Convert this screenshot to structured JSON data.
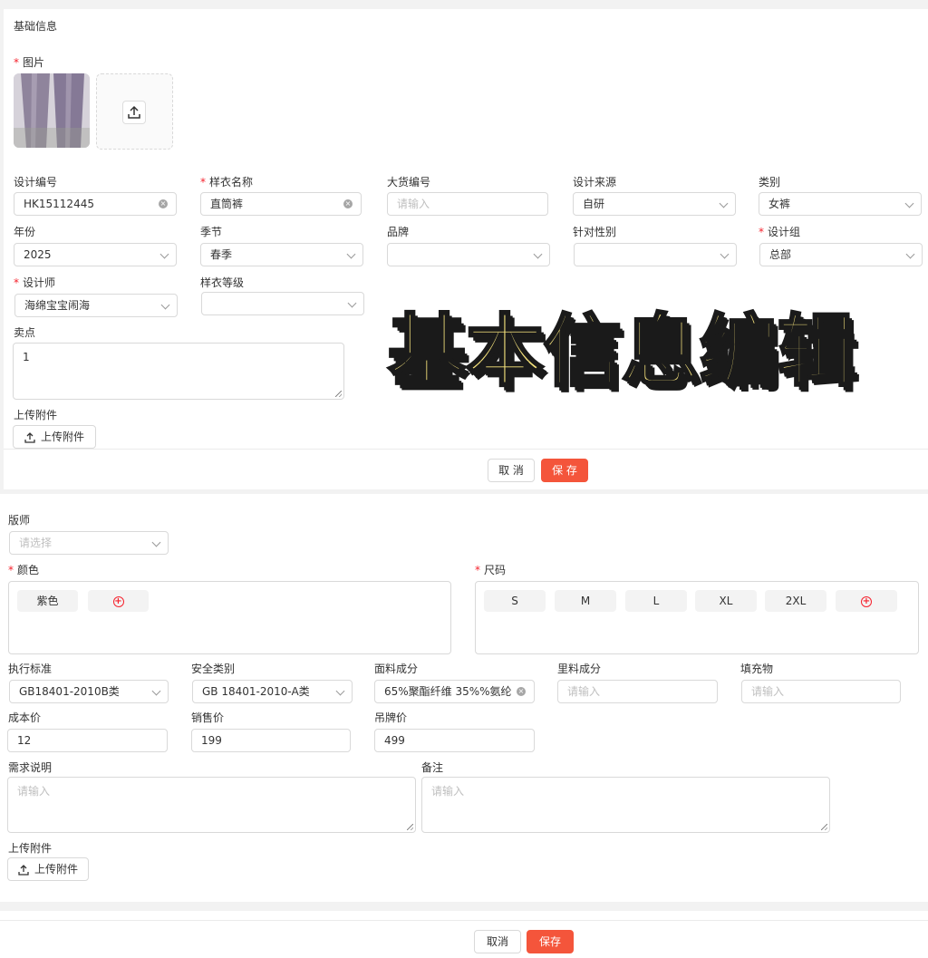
{
  "top": {
    "section_title": "基础信息",
    "image_label": "图片",
    "fields": {
      "design_no": {
        "label": "设计编号",
        "value": "HK15112445"
      },
      "sample_name": {
        "label": "样衣名称",
        "value": "直筒裤"
      },
      "bulk_no": {
        "label": "大货编号",
        "placeholder": "请输入"
      },
      "design_source": {
        "label": "设计来源",
        "value": "自研"
      },
      "category": {
        "label": "类别",
        "value": "女裤"
      },
      "year": {
        "label": "年份",
        "value": "2025"
      },
      "season": {
        "label": "季节",
        "value": "春季"
      },
      "brand": {
        "label": "品牌",
        "value": ""
      },
      "target_gender": {
        "label": "针对性别",
        "value": ""
      },
      "design_group": {
        "label": "设计组",
        "value": "总部"
      },
      "designer": {
        "label": "设计师",
        "value": "海绵宝宝闹海"
      },
      "sample_level": {
        "label": "样衣等级",
        "value": ""
      },
      "selling_point": {
        "label": "卖点",
        "value": "1"
      }
    },
    "attachment": {
      "label": "上传附件",
      "button": "上传附件"
    },
    "cancel": "取 消",
    "save": "保 存"
  },
  "overlay_title": "基本信息编辑",
  "bottom": {
    "pattern_maker": {
      "label": "版师",
      "placeholder": "请选择"
    },
    "color": {
      "label": "颜色",
      "chips": [
        "紫色"
      ]
    },
    "size": {
      "label": "尺码",
      "chips": [
        "S",
        "M",
        "L",
        "XL",
        "2XL"
      ]
    },
    "exec_standard": {
      "label": "执行标准",
      "value": "GB18401-2010B类"
    },
    "safety_class": {
      "label": "安全类别",
      "value": "GB 18401-2010-A类"
    },
    "fabric": {
      "label": "面料成分",
      "value": "65%聚酯纤维 35%%氨纶"
    },
    "lining": {
      "label": "里料成分",
      "placeholder": "请输入"
    },
    "filling": {
      "label": "填充物",
      "placeholder": "请输入"
    },
    "cost": {
      "label": "成本价",
      "value": "12"
    },
    "sale_price": {
      "label": "销售价",
      "value": "199"
    },
    "tag_price": {
      "label": "吊牌价",
      "value": "499"
    },
    "requirements": {
      "label": "需求说明",
      "placeholder": "请输入"
    },
    "remarks": {
      "label": "备注",
      "placeholder": "请输入"
    },
    "attachment": {
      "label": "上传附件",
      "button": "上传附件"
    },
    "cancel": "取消",
    "save": "保存"
  },
  "colors": {
    "accent": "#f4553b",
    "required": "#f5222d",
    "overlay_fill": "#f7e47d"
  }
}
